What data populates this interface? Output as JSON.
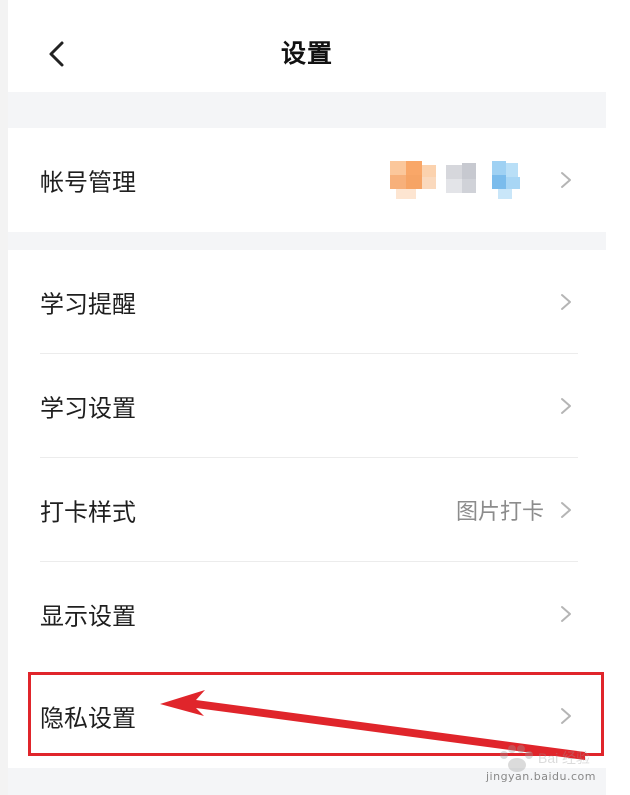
{
  "header": {
    "title": "设置",
    "back_icon": "chevron-left-icon"
  },
  "account": {
    "label": "帐号管理",
    "value_display": "blurred-avatar"
  },
  "settings_items": [
    {
      "label": "学习提醒",
      "value": ""
    },
    {
      "label": "学习设置",
      "value": ""
    },
    {
      "label": "打卡样式",
      "value": "图片打卡"
    },
    {
      "label": "显示设置",
      "value": ""
    },
    {
      "label": "隐私设置",
      "value": ""
    }
  ],
  "annotation": {
    "highlight_color": "#e0252b",
    "highlighted_item": "隐私设置"
  },
  "watermark": {
    "text": "jingyan.baidu.com"
  },
  "colors": {
    "background": "#ffffff",
    "gap": "#f4f5f7",
    "text_primary": "#1f1f1f",
    "text_secondary": "#8c8c8c",
    "chevron": "#b5b5b5"
  }
}
